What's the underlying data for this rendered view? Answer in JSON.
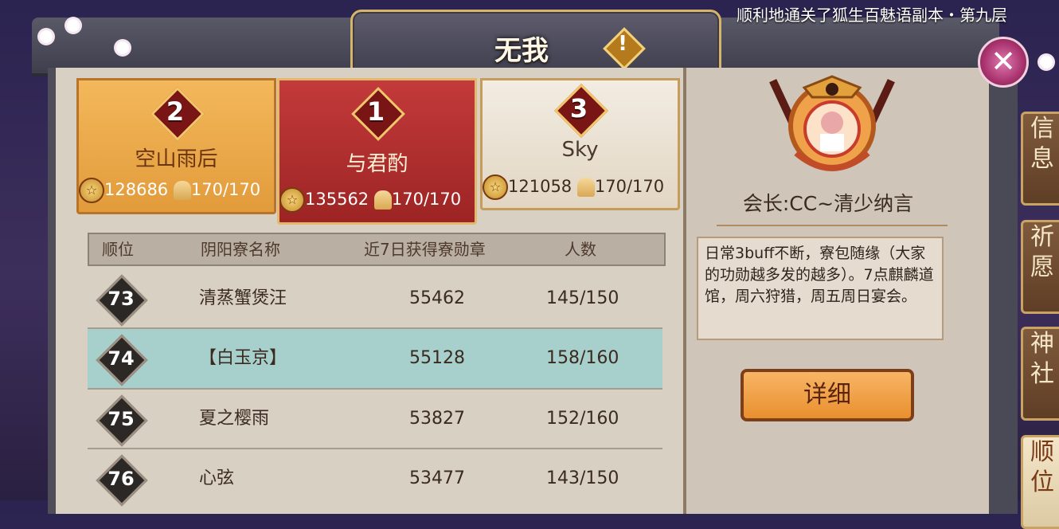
{
  "header": {
    "title": "无我",
    "info_icon_text": "!",
    "marquee": "顺利地通关了狐生百魅语副本・第九层"
  },
  "podium": [
    {
      "rank": "2",
      "name": "空山雨后",
      "medals": "128686",
      "members": "170/170"
    },
    {
      "rank": "1",
      "name": "与君酌",
      "medals": "135562",
      "members": "170/170"
    },
    {
      "rank": "3",
      "name": "Sky",
      "medals": "121058",
      "members": "170/170"
    }
  ],
  "table": {
    "headers": [
      "顺位",
      "阴阳寮名称",
      "近7日获得寮勋章",
      "人数"
    ],
    "rows": [
      {
        "rank": "73",
        "name": "清蒸蟹煲汪",
        "medals": "55462",
        "members": "145/150"
      },
      {
        "rank": "74",
        "name": "【白玉京】",
        "medals": "55128",
        "members": "158/160"
      },
      {
        "rank": "75",
        "name": "夏之樱雨",
        "medals": "53827",
        "members": "152/160"
      },
      {
        "rank": "76",
        "name": "心弦",
        "medals": "53477",
        "members": "143/150"
      }
    ]
  },
  "guild_info": {
    "leader": "会长:CC~清少纳言",
    "description": "日常3buff不断，寮包随缘（大家的功勋越多发的越多）。7点麒麟道馆，周六狩猎，周五周日宴会。",
    "detail_button": "详细"
  },
  "side_tabs": [
    "信息",
    "祈愿",
    "神社",
    "顺位"
  ],
  "close_icon_text": "✕"
}
